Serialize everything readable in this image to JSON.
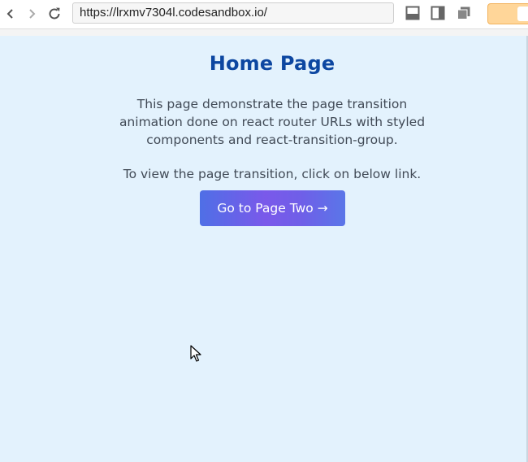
{
  "browser": {
    "url": "https://lrxmv7304l.codesandbox.io/"
  },
  "page": {
    "title": "Home Page",
    "description": "This page demonstrate the page transition animation done on react router URLs with styled components and react-transition-group.",
    "instruction": "To view the page transition, click on below link.",
    "button_label": "Go to Page Two →"
  },
  "colors": {
    "background": "#e3f2fd",
    "title": "#0d47a1",
    "button_start": "#4f6fe6",
    "button_mid": "#7a59ea"
  }
}
